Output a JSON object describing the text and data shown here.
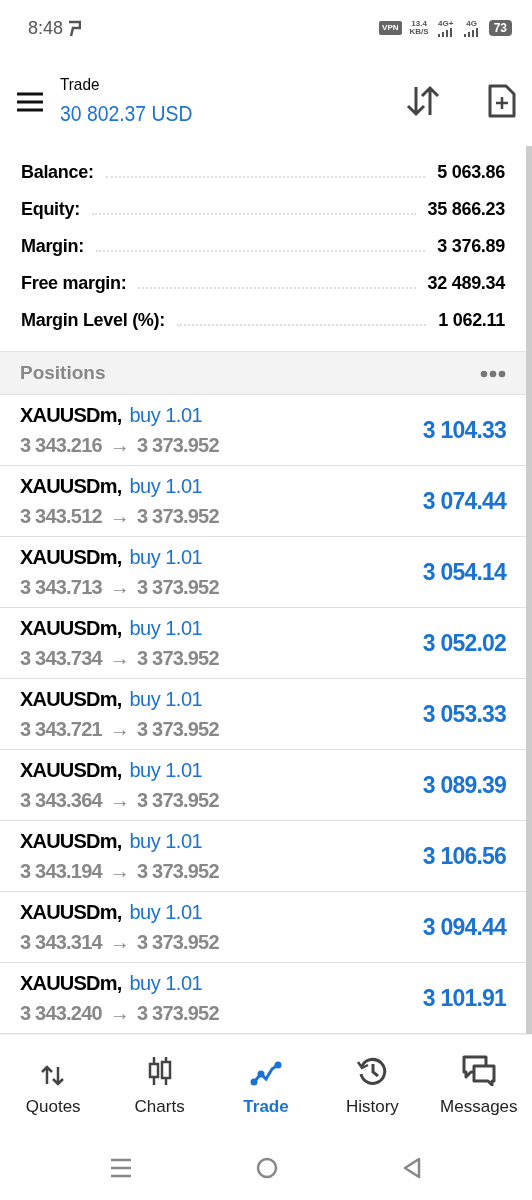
{
  "status_bar": {
    "time": "8:48",
    "vpn": "VPN",
    "speed": [
      "13.4",
      "KB/S"
    ],
    "networks": [
      "4G+",
      "4G"
    ],
    "battery": "73"
  },
  "header": {
    "title": "Trade",
    "balance": "30 802.37 USD"
  },
  "summary": [
    {
      "label": "Balance:",
      "value": "5 063.86"
    },
    {
      "label": "Equity:",
      "value": "35 866.23"
    },
    {
      "label": "Margin:",
      "value": "3 376.89"
    },
    {
      "label": "Free margin:",
      "value": "32 489.34"
    },
    {
      "label": "Margin Level (%):",
      "value": "1 062.11"
    }
  ],
  "positions": {
    "title": "Positions",
    "rows": [
      {
        "symbol": "XAUUSDm,",
        "order": "buy 1.01",
        "open": "3 343.216",
        "arrow": "→",
        "current": "3 373.952",
        "profit": "3 104.33"
      },
      {
        "symbol": "XAUUSDm,",
        "order": "buy 1.01",
        "open": "3 343.512",
        "arrow": "→",
        "current": "3 373.952",
        "profit": "3 074.44"
      },
      {
        "symbol": "XAUUSDm,",
        "order": "buy 1.01",
        "open": "3 343.713",
        "arrow": "→",
        "current": "3 373.952",
        "profit": "3 054.14"
      },
      {
        "symbol": "XAUUSDm,",
        "order": "buy 1.01",
        "open": "3 343.734",
        "arrow": "→",
        "current": "3 373.952",
        "profit": "3 052.02"
      },
      {
        "symbol": "XAUUSDm,",
        "order": "buy 1.01",
        "open": "3 343.721",
        "arrow": "→",
        "current": "3 373.952",
        "profit": "3 053.33"
      },
      {
        "symbol": "XAUUSDm,",
        "order": "buy 1.01",
        "open": "3 343.364",
        "arrow": "→",
        "current": "3 373.952",
        "profit": "3 089.39"
      },
      {
        "symbol": "XAUUSDm,",
        "order": "buy 1.01",
        "open": "3 343.194",
        "arrow": "→",
        "current": "3 373.952",
        "profit": "3 106.56"
      },
      {
        "symbol": "XAUUSDm,",
        "order": "buy 1.01",
        "open": "3 343.314",
        "arrow": "→",
        "current": "3 373.952",
        "profit": "3 094.44"
      },
      {
        "symbol": "XAUUSDm,",
        "order": "buy 1.01",
        "open": "3 343.240",
        "arrow": "→",
        "current": "3 373.952",
        "profit": "3 101.91"
      }
    ]
  },
  "bottom_nav": [
    {
      "label": "Quotes",
      "kind": "quotes",
      "selected": false
    },
    {
      "label": "Charts",
      "kind": "charts",
      "selected": false
    },
    {
      "label": "Trade",
      "kind": "trade",
      "selected": true
    },
    {
      "label": "History",
      "kind": "history",
      "selected": false
    },
    {
      "label": "Messages",
      "kind": "messages",
      "selected": false
    }
  ]
}
